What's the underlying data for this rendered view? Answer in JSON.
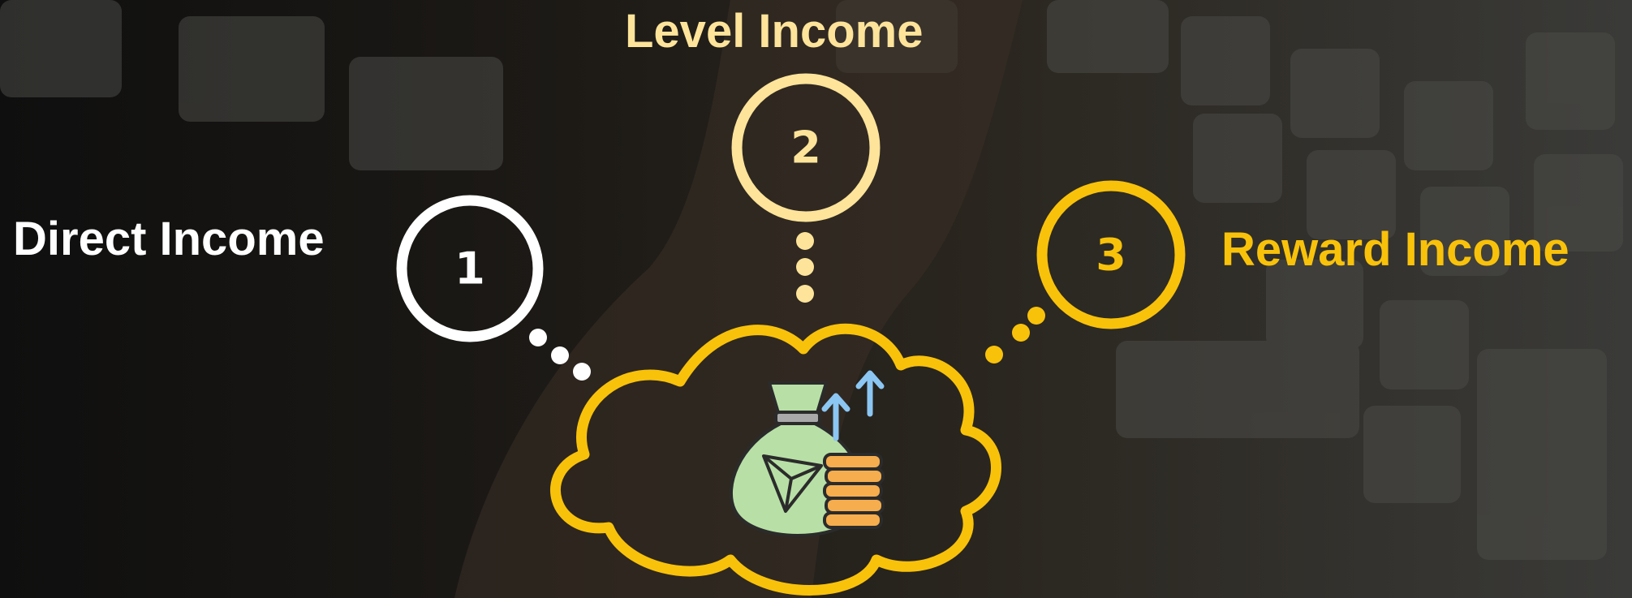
{
  "items": [
    {
      "number": "1",
      "label": "Direct Income",
      "color": "#ffffff"
    },
    {
      "number": "2",
      "label": "Level Income",
      "color": "#fde49a"
    },
    {
      "number": "3",
      "label": "Reward Income",
      "color": "#f9c20a"
    }
  ],
  "colors": {
    "cloud_outline": "#f9c20a",
    "money_bag": "#b8e0a6",
    "coins": "#f5ad4d",
    "arrows": "#8cc6f3",
    "background": "#1a1916"
  },
  "icons": [
    "cloud-icon",
    "money-bag-icon",
    "tron-logo-icon",
    "coin-stack-icon",
    "growth-arrow-icon"
  ]
}
